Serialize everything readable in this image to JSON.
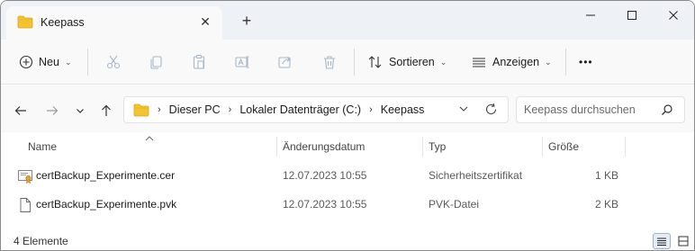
{
  "window": {
    "tab_title": "Keepass",
    "new_tab_label": "+",
    "minimize_label": "—",
    "maximize_label": "☐",
    "close_label": "✕",
    "tab_close_label": "✕"
  },
  "toolbar": {
    "new_label": "Neu",
    "sort_label": "Sortieren",
    "view_label": "Anzeigen",
    "more_label": "•••",
    "icons": [
      "plus-circle-icon",
      "scissors-icon",
      "copy-icon",
      "paste-icon",
      "rename-icon",
      "share-icon",
      "delete-icon",
      "sort-icon",
      "view-icon"
    ]
  },
  "address": {
    "crumbs": [
      "Dieser PC",
      "Lokaler Datenträger (C:)",
      "Keepass"
    ],
    "crumb_separator": "›",
    "search_placeholder": "Keepass durchsuchen"
  },
  "columns": {
    "name": "Name",
    "modified": "Änderungsdatum",
    "type": "Typ",
    "size": "Größe"
  },
  "files": [
    {
      "name": "certBackup_Experimente.cer",
      "modified": "12.07.2023 10:55",
      "type": "Sicherheitszertifikat",
      "size": "1 KB",
      "icon": "certificate-file-icon"
    },
    {
      "name": "certBackup_Experimente.pvk",
      "modified": "12.07.2023 10:55",
      "type": "PVK-Datei",
      "size": "2 KB",
      "icon": "generic-file-icon"
    }
  ],
  "status": {
    "item_count": "4 Elemente"
  },
  "colors": {
    "folder_yellow": "#f4c430",
    "accent": "#005fb8",
    "titlebar_bg": "#eef1f6"
  }
}
